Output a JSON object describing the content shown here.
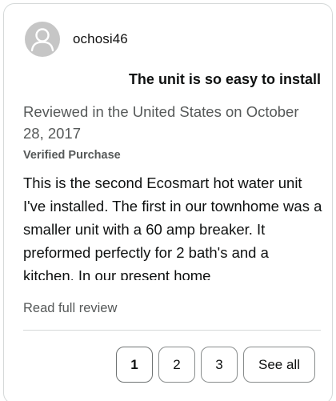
{
  "reviewer": {
    "name": "ochosi46",
    "avatar_icon": "default-user-avatar-icon"
  },
  "review": {
    "title": "The unit is so easy to install",
    "date": "Reviewed in the United States on October 28, 2017",
    "verified": "Verified Purchase",
    "body": "This is the second Ecosmart hot water unit I've installed. The first in our townhome was a smaller unit with a 60 amp breaker. It preformed perfectly for 2 bath's and a kitchen. In our present home",
    "read_full": "Read full review"
  },
  "pagination": {
    "pages": [
      "1",
      "2",
      "3"
    ],
    "active": "1",
    "see_all": "See all"
  },
  "colors": {
    "border": "#d5d9d9",
    "muted_text": "#565959",
    "text": "#0f1111",
    "avatar_bg": "#c6c6c6"
  }
}
